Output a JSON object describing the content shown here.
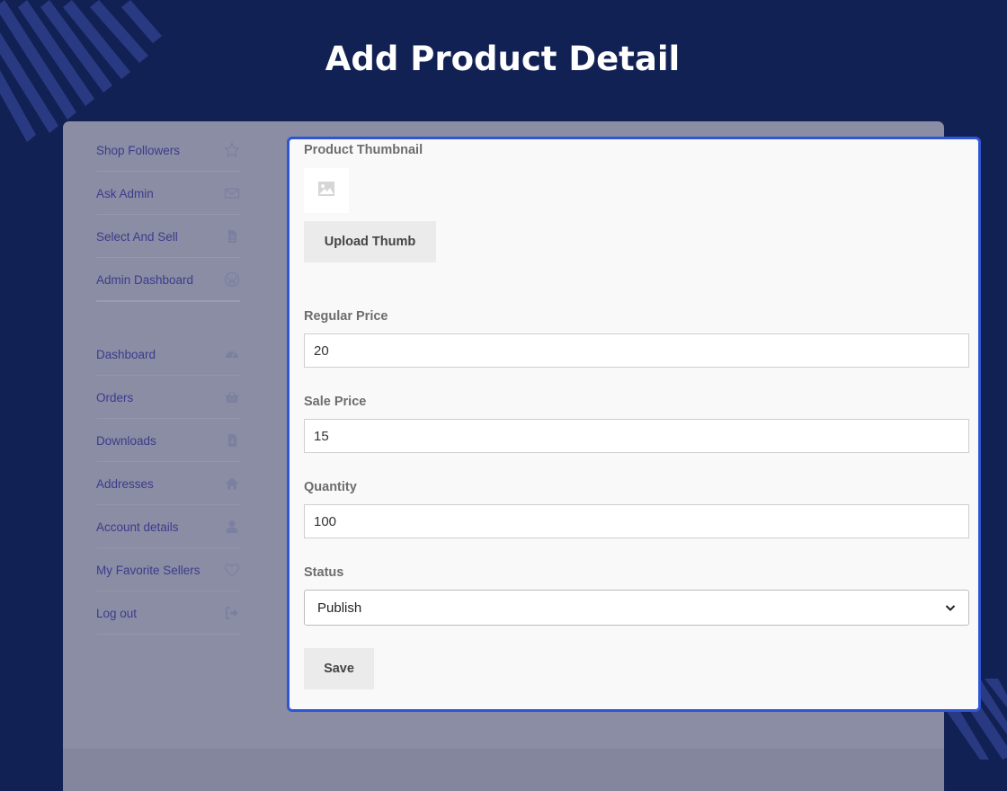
{
  "page": {
    "title": "Add Product Detail"
  },
  "sidebar": {
    "items": [
      {
        "label": "Shop Followers",
        "icon": "star-icon"
      },
      {
        "label": "Ask Admin",
        "icon": "envelope-icon"
      },
      {
        "label": "Select And Sell",
        "icon": "document-icon"
      },
      {
        "label": "Admin Dashboard",
        "icon": "wordpress-icon"
      },
      {
        "label": "Dashboard",
        "icon": "gauge-icon"
      },
      {
        "label": "Orders",
        "icon": "basket-icon"
      },
      {
        "label": "Downloads",
        "icon": "file-download-icon"
      },
      {
        "label": "Addresses",
        "icon": "home-icon"
      },
      {
        "label": "Account details",
        "icon": "user-icon"
      },
      {
        "label": "My Favorite Sellers",
        "icon": "heart-icon"
      },
      {
        "label": "Log out",
        "icon": "sign-out-icon"
      }
    ]
  },
  "form": {
    "thumbnail_label": "Product Thumbnail",
    "upload_button": "Upload Thumb",
    "regular_price_label": "Regular Price",
    "regular_price_value": "20",
    "sale_price_label": "Sale Price",
    "sale_price_value": "15",
    "quantity_label": "Quantity",
    "quantity_value": "100",
    "status_label": "Status",
    "status_value": "Publish",
    "save_button": "Save"
  },
  "colors": {
    "background": "#122154",
    "modal_border": "#2f55d4",
    "sidebar_text": "#3d3b8e"
  }
}
